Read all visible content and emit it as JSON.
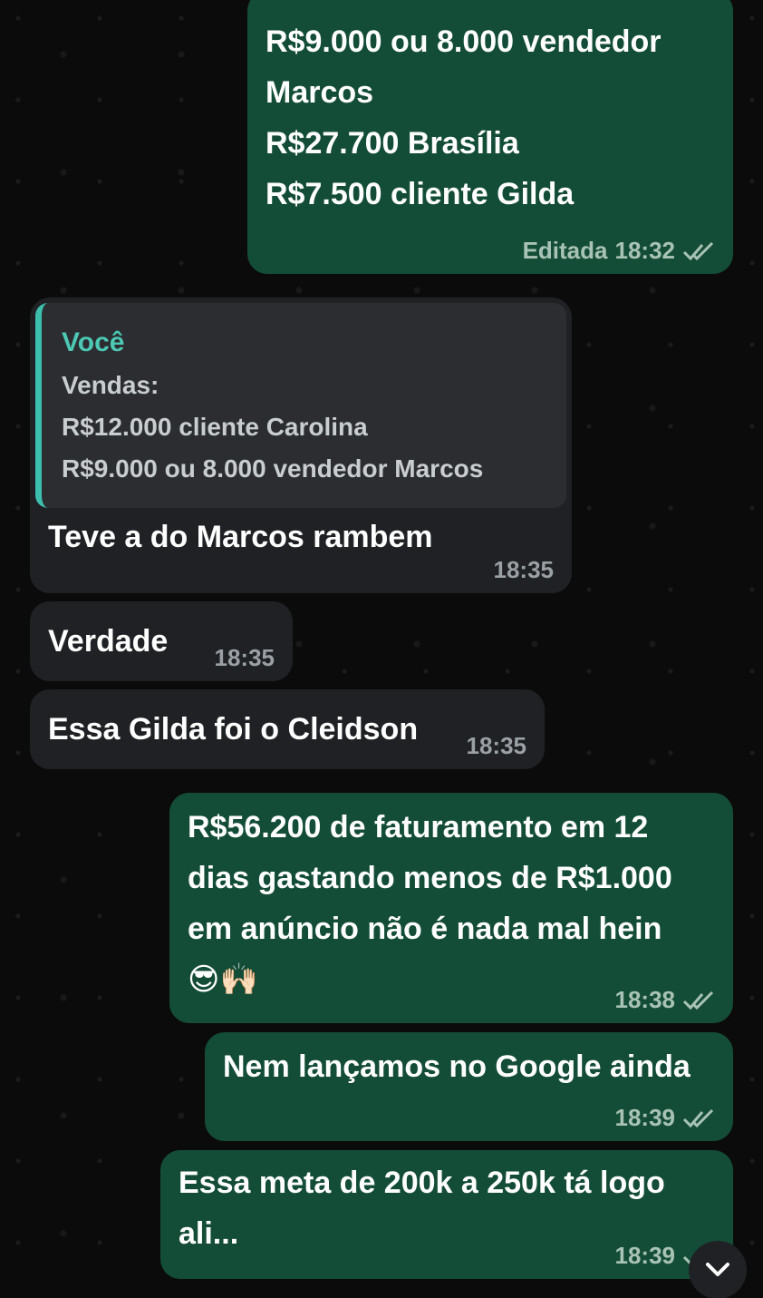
{
  "messages": [
    {
      "id": "m1",
      "direction": "outgoing",
      "lines": [
        "R$9.000 ou 8.000 vendedor",
        "Marcos",
        "R$27.700 Brasília",
        "R$7.500 cliente Gilda"
      ],
      "edited_label": "Editada",
      "time": "18:32",
      "status": "read"
    },
    {
      "id": "m2",
      "direction": "incoming",
      "quote": {
        "author": "Você",
        "lines": [
          "Vendas:",
          "R$12.000 cliente Carolina",
          "R$9.000 ou 8.000 vendedor Marcos"
        ]
      },
      "text": "Teve a do Marcos rambem",
      "time": "18:35"
    },
    {
      "id": "m3",
      "direction": "incoming",
      "text": "Verdade",
      "time": "18:35"
    },
    {
      "id": "m4",
      "direction": "incoming",
      "text": "Essa Gilda foi o Cleidson",
      "time": "18:35"
    },
    {
      "id": "m5",
      "direction": "outgoing",
      "lines": [
        "R$56.200 de faturamento em 12",
        "dias gastando menos de R$1.000",
        "em anúncio não é nada mal hein"
      ],
      "emoji": "😎🙌🏻",
      "time": "18:38",
      "status": "read"
    },
    {
      "id": "m6",
      "direction": "outgoing",
      "text": "Nem lançamos no Google ainda",
      "time": "18:39",
      "status": "read"
    },
    {
      "id": "m7",
      "direction": "outgoing",
      "lines": [
        "Essa meta de 200k a 250k tá logo",
        "ali..."
      ],
      "time": "18:39",
      "status": "read"
    }
  ],
  "icons": {
    "read_ticks": "double-check-icon",
    "scroll_down": "chevron-down-icon"
  },
  "colors": {
    "outgoing_bubble": "#144d37",
    "incoming_bubble": "#1f2124",
    "quote_accent": "#3dbfae",
    "quote_author": "#4cc8b4"
  }
}
